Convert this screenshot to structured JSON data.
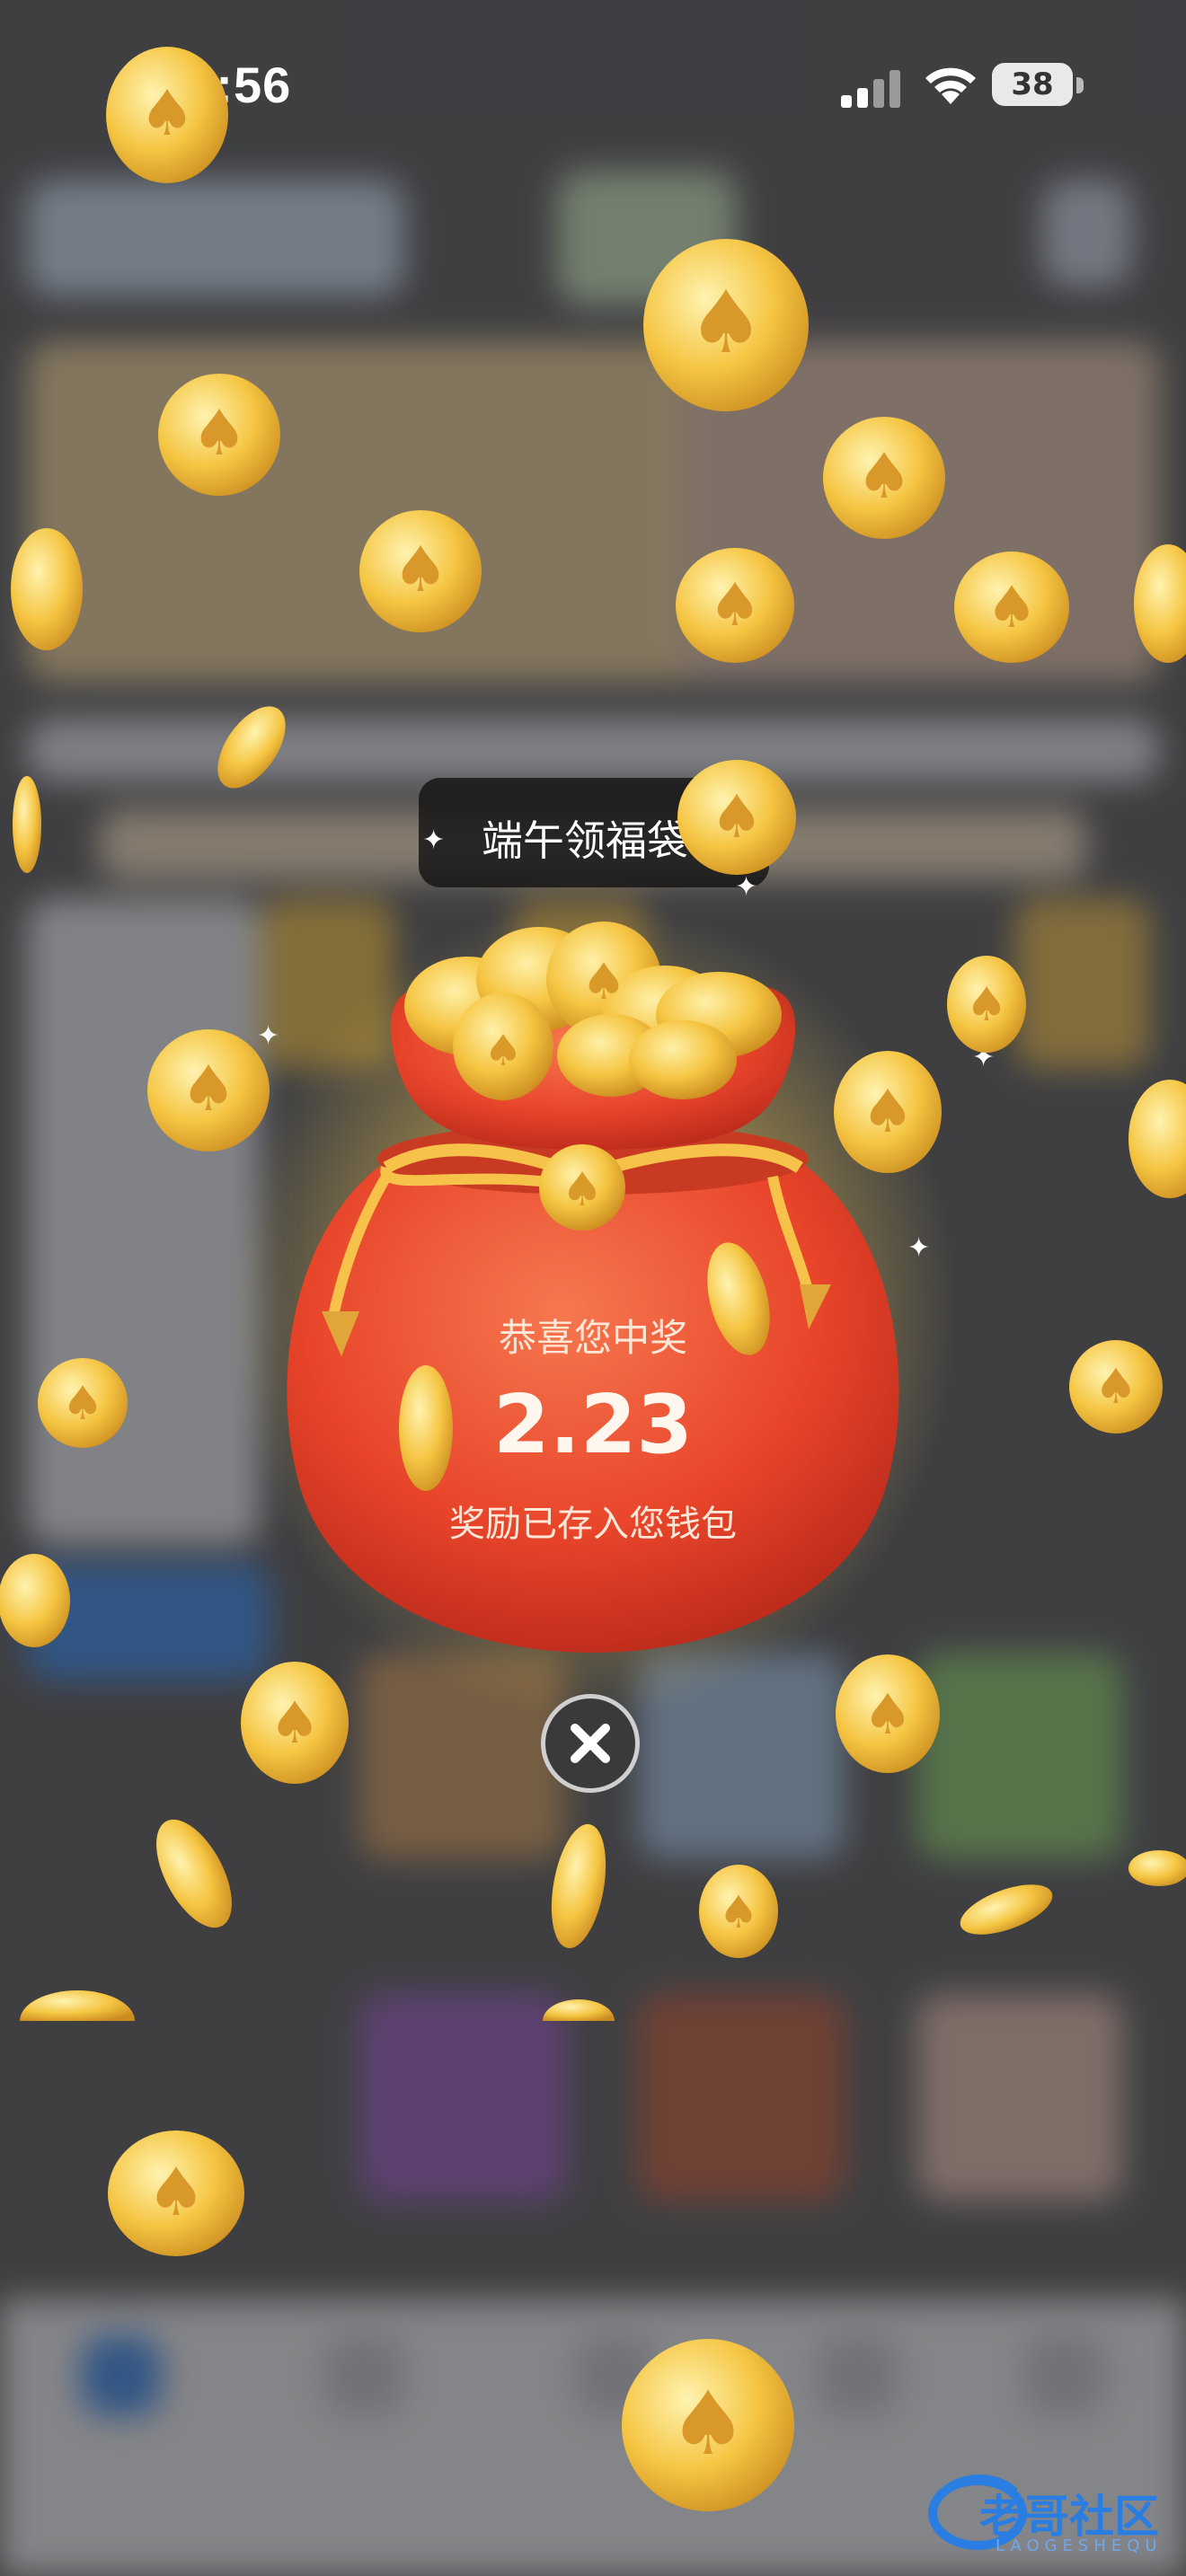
{
  "status_bar": {
    "time": "02:56",
    "battery": "38"
  },
  "popup": {
    "title": "端午领福袋",
    "congrats": "恭喜您中奖",
    "amount": "2.23",
    "deposit_note": "奖励已存入您钱包"
  },
  "watermark": {
    "text": "老哥社区",
    "subtext": "LAOGESHEQU"
  },
  "colors": {
    "bag_red": "#e8452a",
    "coin_gold": "#f5c542",
    "glow_yellow": "#ffe27a",
    "watermark_blue": "#2a7de1"
  },
  "icons": [
    "signal-icon",
    "wifi-icon",
    "battery-icon",
    "close-icon",
    "spade-coin-icon",
    "sparkle-icon"
  ]
}
